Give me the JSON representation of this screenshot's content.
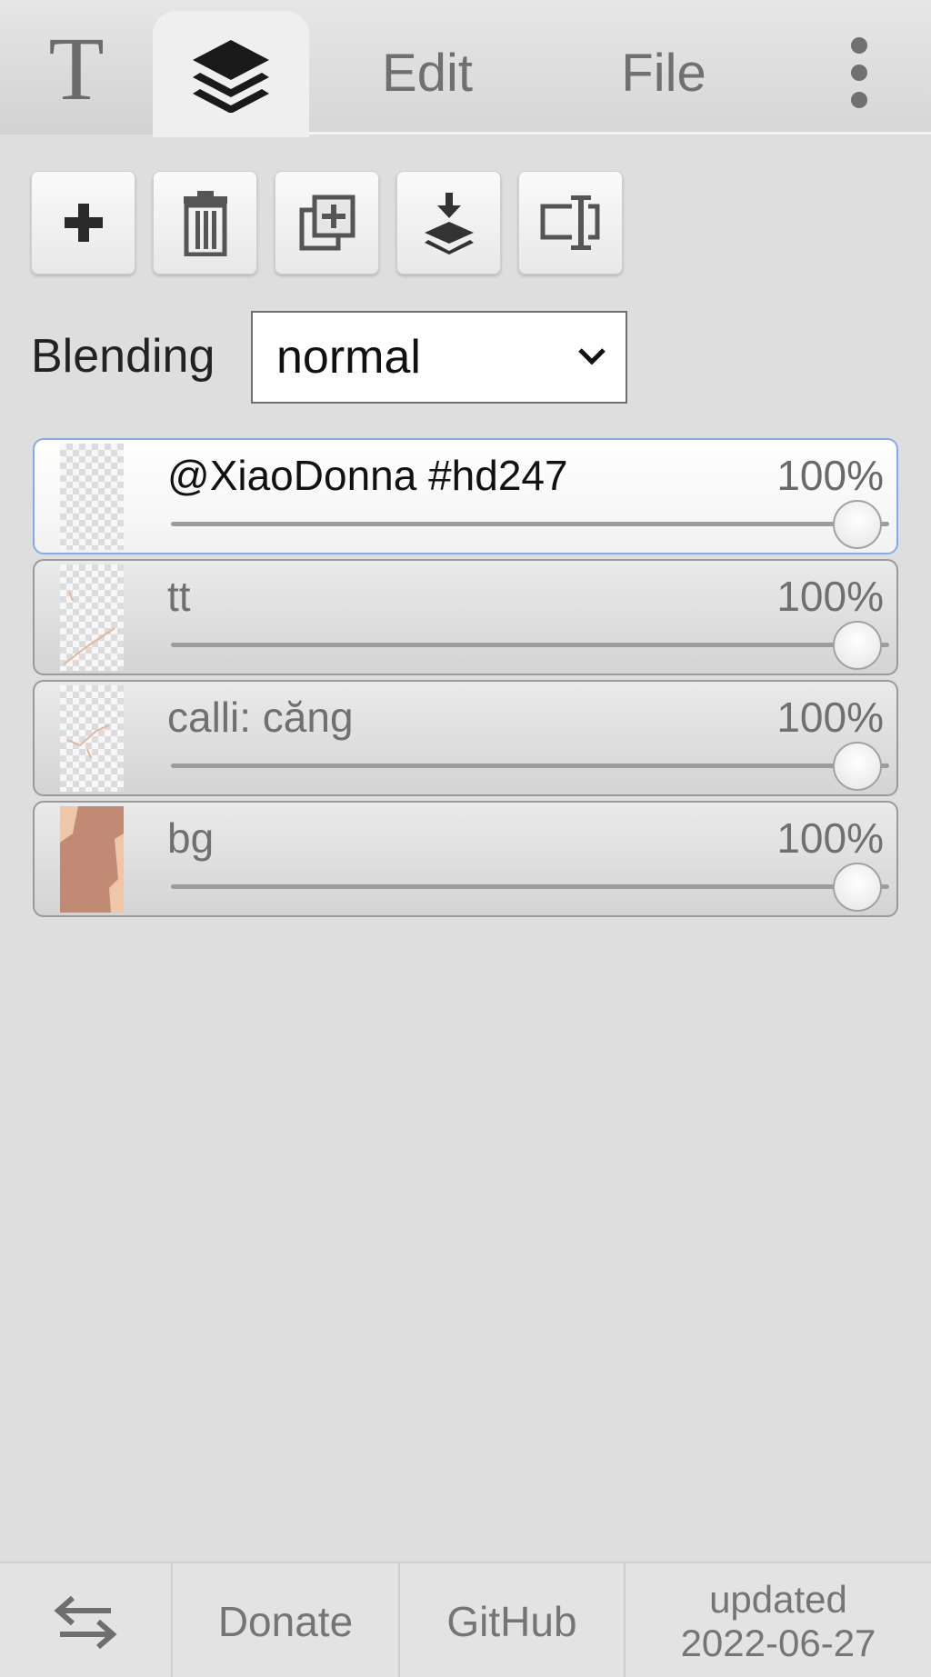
{
  "tabs": {
    "text_tool_glyph": "T",
    "edit_label": "Edit",
    "file_label": "File"
  },
  "toolbar": {
    "icons": [
      "plus-icon",
      "trash-icon",
      "duplicate-icon",
      "merge-down-icon",
      "rename-icon"
    ]
  },
  "blending": {
    "label": "Blending",
    "selected": "normal"
  },
  "layers": [
    {
      "name": "@XiaoDonna #hd247",
      "opacity": "100%",
      "opacity_value": 1.0,
      "active": true,
      "thumb": "transparent"
    },
    {
      "name": "tt",
      "opacity": "100%",
      "opacity_value": 1.0,
      "active": false,
      "thumb": "sketch"
    },
    {
      "name": "calli: căng",
      "opacity": "100%",
      "opacity_value": 1.0,
      "active": false,
      "thumb": "sketch"
    },
    {
      "name": "bg",
      "opacity": "100%",
      "opacity_value": 1.0,
      "active": false,
      "thumb": "skin"
    }
  ],
  "footer": {
    "donate_label": "Donate",
    "github_label": "GitHub",
    "updated_label": "updated",
    "updated_date": "2022-06-27"
  },
  "colors": {
    "active_border": "#86a9ee",
    "thumb_skin": "#c08a74",
    "thumb_skin_light": "#eec6a8"
  }
}
